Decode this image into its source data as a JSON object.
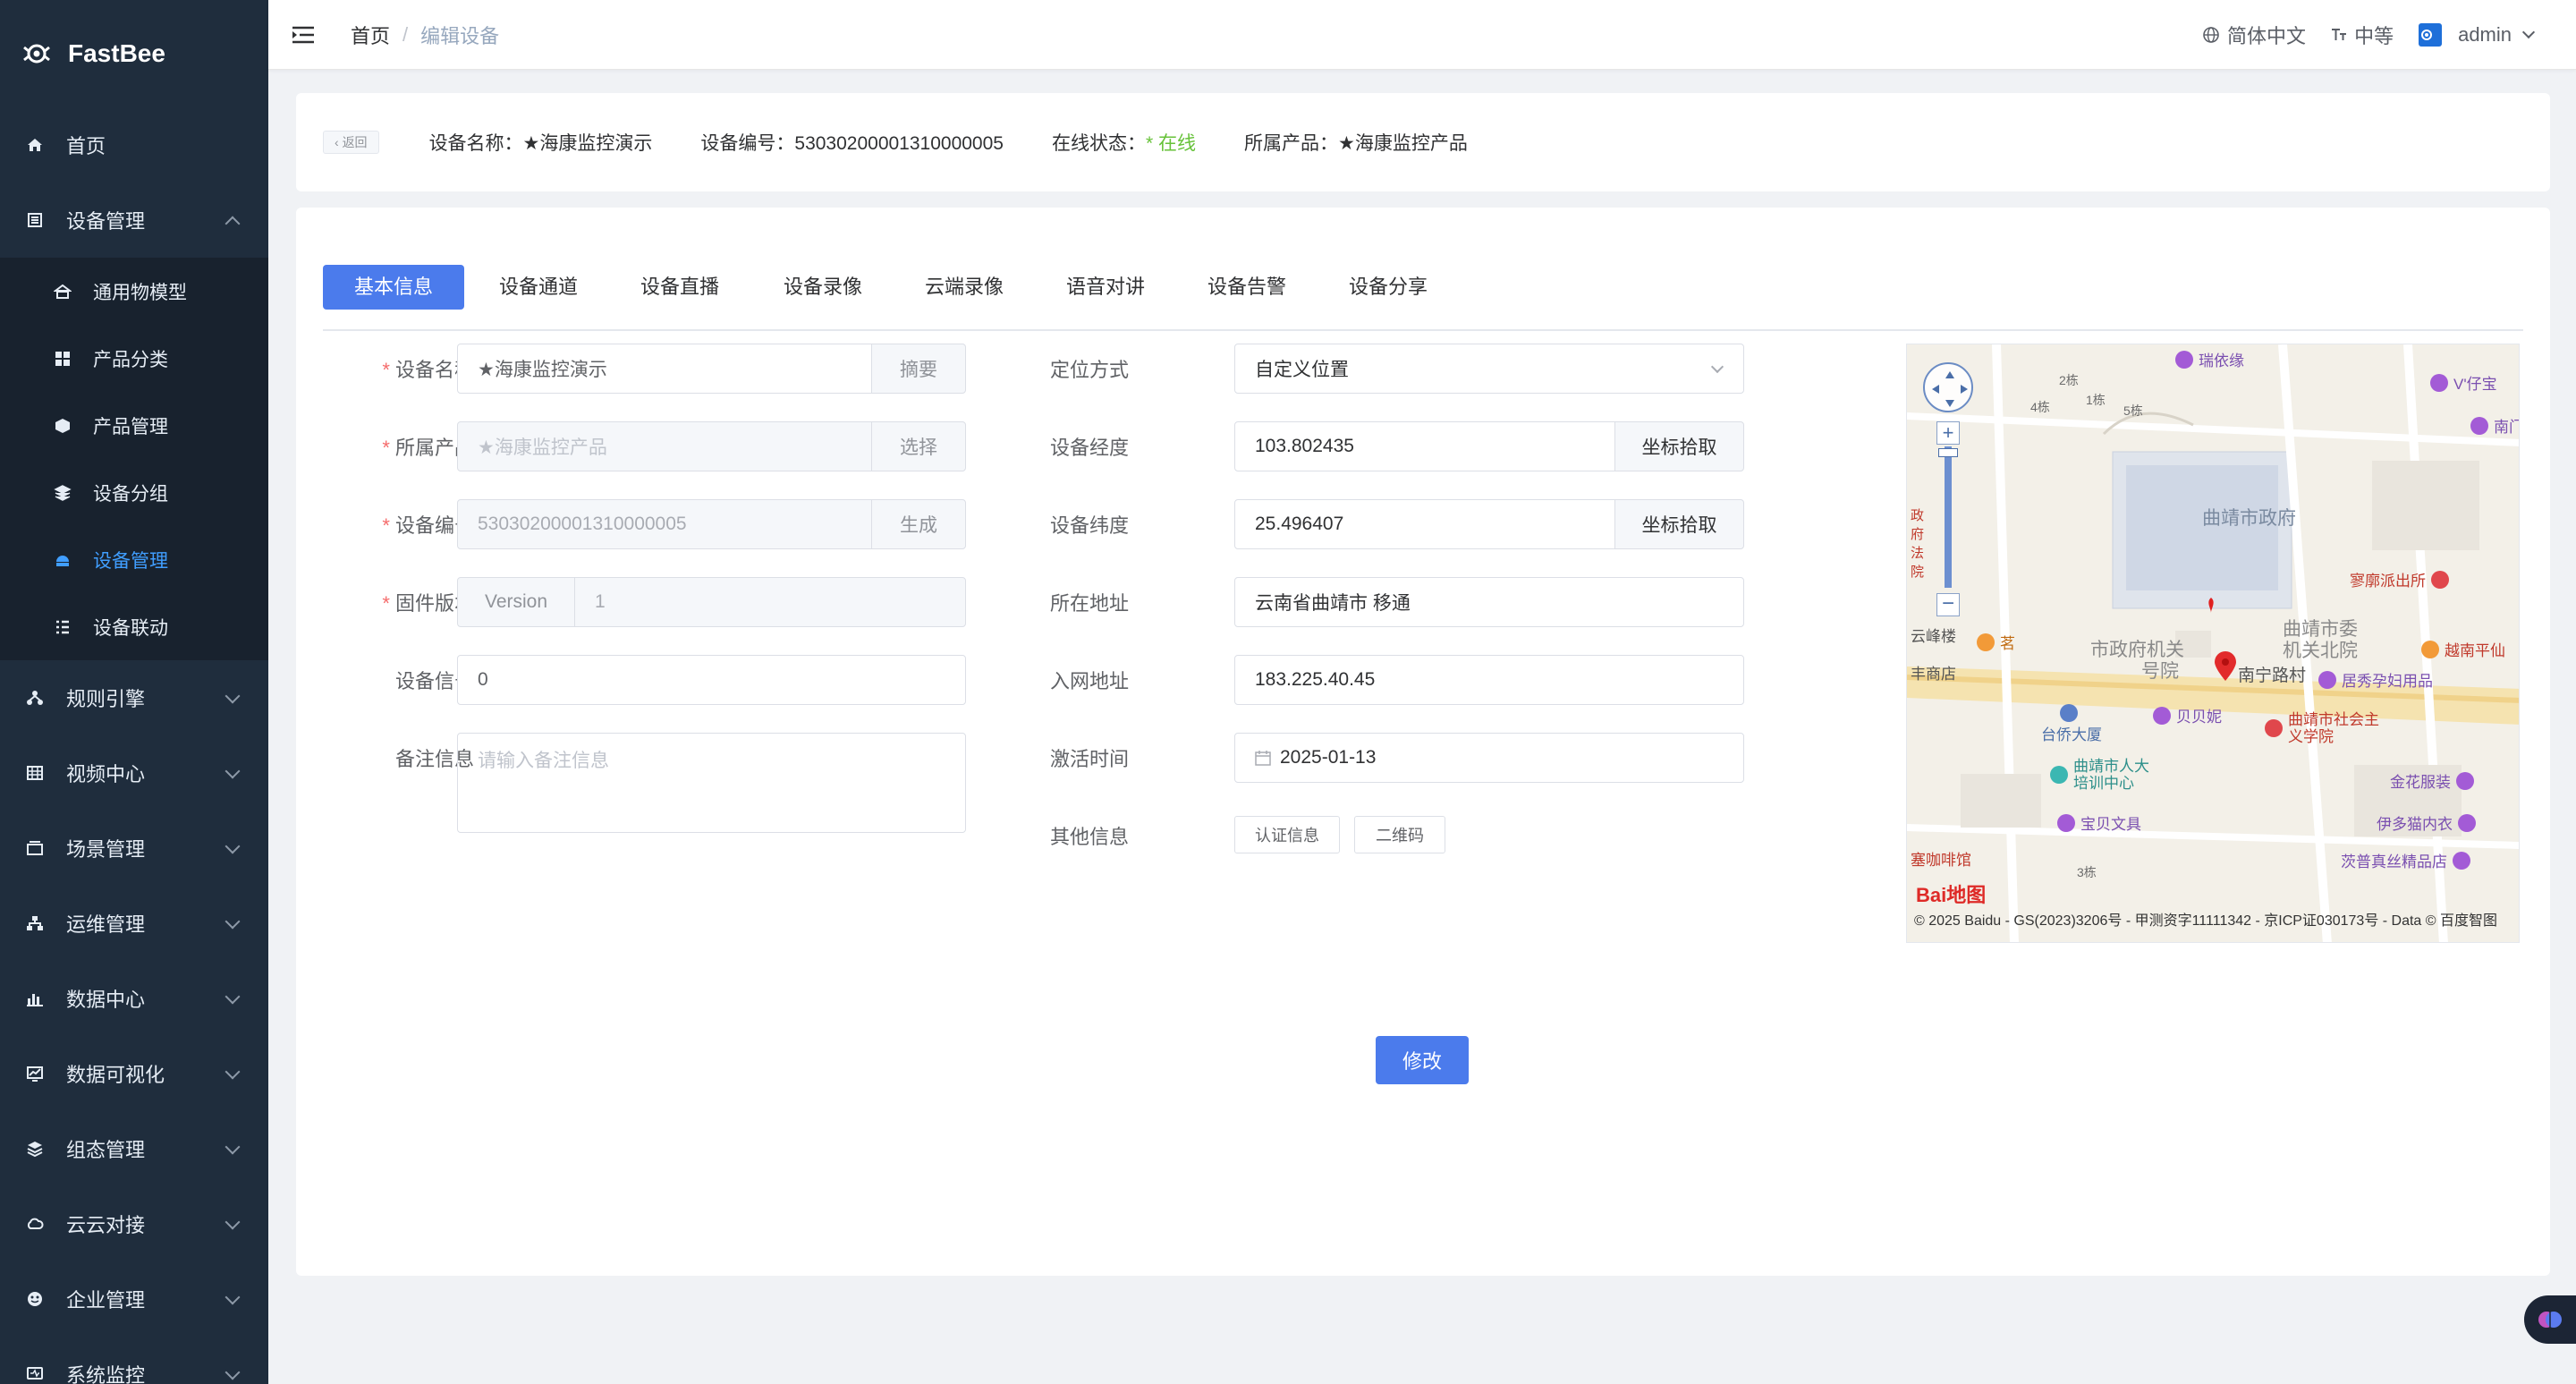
{
  "app": {
    "name": "FastBee"
  },
  "sidebar": {
    "items": [
      {
        "label": "首页",
        "icon": "home-icon"
      },
      {
        "label": "设备管理",
        "icon": "device-icon",
        "expanded": true
      },
      {
        "label": "规则引擎",
        "icon": "rule-icon"
      },
      {
        "label": "视频中心",
        "icon": "video-icon"
      },
      {
        "label": "场景管理",
        "icon": "scene-icon"
      },
      {
        "label": "运维管理",
        "icon": "ops-icon"
      },
      {
        "label": "数据中心",
        "icon": "data-icon"
      },
      {
        "label": "数据可视化",
        "icon": "visual-icon"
      },
      {
        "label": "组态管理",
        "icon": "layers-icon"
      },
      {
        "label": "云云对接",
        "icon": "cloud-icon"
      },
      {
        "label": "企业管理",
        "icon": "enterprise-icon"
      },
      {
        "label": "系统监控",
        "icon": "monitor-icon"
      }
    ],
    "sub_items": [
      {
        "label": "通用物模型",
        "icon": "model-icon"
      },
      {
        "label": "产品分类",
        "icon": "category-icon"
      },
      {
        "label": "产品管理",
        "icon": "product-icon"
      },
      {
        "label": "设备分组",
        "icon": "group-icon"
      },
      {
        "label": "设备管理",
        "icon": "device-manage-icon",
        "active": true
      },
      {
        "label": "设备联动",
        "icon": "link-icon"
      }
    ]
  },
  "header": {
    "breadcrumb": [
      "首页",
      "编辑设备"
    ],
    "breadcrumb_sep": "/",
    "language": "简体中文",
    "size": "中等",
    "user": "admin"
  },
  "info": {
    "back": "返回",
    "device_name": "设备名称：★海康监控演示",
    "device_no": "设备编号：53030200001310000005",
    "status_label": "在线状态：",
    "status_value": "在线",
    "product": "所属产品：★海康监控产品"
  },
  "tabs": [
    "基本信息",
    "设备通道",
    "设备直播",
    "设备录像",
    "云端录像",
    "语音对讲",
    "设备告警",
    "设备分享"
  ],
  "form": {
    "device_name": {
      "label": "设备名称",
      "value": "★海康监控演示",
      "append": "摘要"
    },
    "product": {
      "label": "所属产品",
      "placeholder": "★海康监控产品",
      "append": "选择"
    },
    "serial": {
      "label": "设备编号",
      "value": "53030200001310000005",
      "append": "生成"
    },
    "firmware": {
      "label": "固件版本",
      "prepend": "Version",
      "value": "1"
    },
    "signal": {
      "label": "设备信号",
      "value": "0"
    },
    "remark": {
      "label": "备注信息",
      "placeholder": "请输入备注信息"
    },
    "locate": {
      "label": "定位方式",
      "value": "自定义位置"
    },
    "longitude": {
      "label": "设备经度",
      "value": "103.802435",
      "append": "坐标拾取"
    },
    "latitude": {
      "label": "设备纬度",
      "value": "25.496407",
      "append": "坐标拾取"
    },
    "address": {
      "label": "所在地址",
      "value": "云南省曲靖市 移通"
    },
    "network": {
      "label": "入网地址",
      "value": "183.225.40.45"
    },
    "activate": {
      "label": "激活时间",
      "value": "2025-01-13"
    },
    "other": {
      "label": "其他信息",
      "btn_auth": "认证信息",
      "btn_qr": "二维码"
    },
    "submit": "修改"
  },
  "map": {
    "labels": [
      "曲靖市政府",
      "市政府机关",
      "号院",
      "曲靖市委",
      "机关北院",
      "南宁路村",
      "2栋",
      "4栋",
      "1栋",
      "5栋",
      "3栋"
    ],
    "pois": [
      {
        "name": "瑞依缘",
        "color": "#a35bd6"
      },
      {
        "name": "V'仔宝",
        "color": "#a35bd6"
      },
      {
        "name": "南门i",
        "color": "#a35bd6"
      },
      {
        "name": "寥廓派出所",
        "color": "#e0474c"
      },
      {
        "name": "越南平仙",
        "color": "#f29a38"
      },
      {
        "name": "居秀孕妇用品",
        "color": "#a35bd6"
      },
      {
        "name": "贝贝妮",
        "color": "#a35bd6"
      },
      {
        "name": "曲靖市社会主义学院",
        "color": "#e0474c"
      },
      {
        "name": "台侨大厦",
        "color": "#5a7fc8"
      },
      {
        "name": "曲靖市人大培训中心",
        "color": "#3bb7b2"
      },
      {
        "name": "宝贝文具",
        "color": "#a35bd6"
      },
      {
        "name": "金花服装",
        "color": "#a35bd6"
      },
      {
        "name": "伊多猫内衣",
        "color": "#a35bd6"
      },
      {
        "name": "茨普真丝精品店",
        "color": "#a35bd6"
      },
      {
        "name": "云峰楼",
        "color": "#888888"
      },
      {
        "name": "茗",
        "color": "#f29a38"
      },
      {
        "name": "丰商店",
        "color": "#888888"
      },
      {
        "name": "塞咖啡馆",
        "color": "#888888"
      }
    ],
    "left_edge_text": "政府法院",
    "copyright": "© 2025 Baidu - GS(2023)3206号 - 甲测资字11111342 - 京ICP证030173号 - Data © 百度智图",
    "logo": "Bai地图"
  },
  "colors": {
    "primary": "#4b7bec",
    "sidebar": "#1f2d3d",
    "online": "#67c23a",
    "required": "#f56c6c"
  }
}
